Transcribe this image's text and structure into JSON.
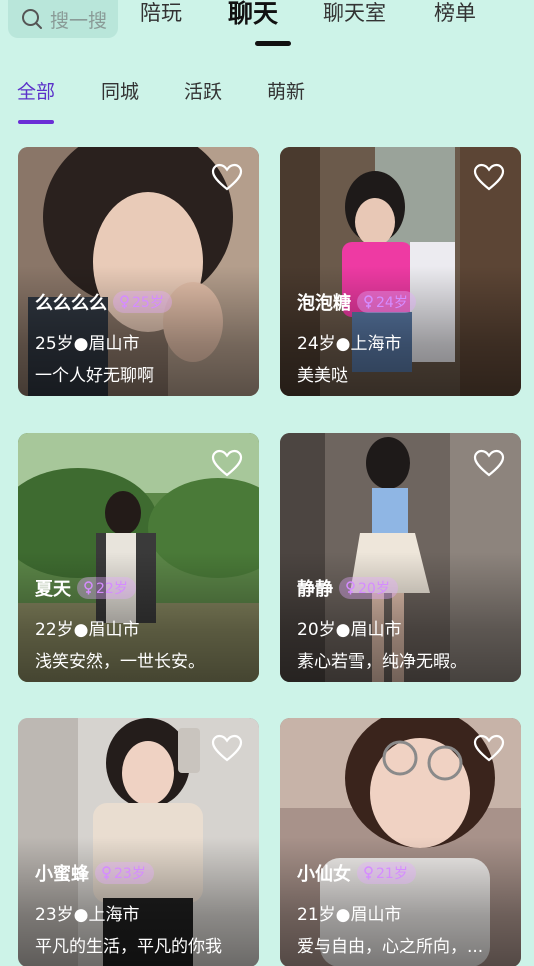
{
  "search": {
    "placeholder": "搜一搜"
  },
  "top_tabs": [
    {
      "label": "陪玩"
    },
    {
      "label": "聊天"
    },
    {
      "label": "聊天室"
    },
    {
      "label": "榜单"
    }
  ],
  "sub_tabs": [
    {
      "label": "全部"
    },
    {
      "label": "同城"
    },
    {
      "label": "活跃"
    },
    {
      "label": "萌新"
    }
  ],
  "cards": [
    {
      "name": "么么么么",
      "age_badge": "25岁",
      "info": "25岁●眉山市",
      "motto": "一个人好无聊啊"
    },
    {
      "name": "泡泡糖",
      "age_badge": "24岁",
      "info": "24岁●上海市",
      "motto": "美美哒"
    },
    {
      "name": "夏天",
      "age_badge": "22岁",
      "info": "22岁●眉山市",
      "motto": "浅笑安然，一世长安。"
    },
    {
      "name": "静静",
      "age_badge": "20岁",
      "info": "20岁●眉山市",
      "motto": "素心若雪，纯净无暇。"
    },
    {
      "name": "小蜜蜂",
      "age_badge": "23岁",
      "info": "23岁●上海市",
      "motto": "平凡的生活，平凡的你我"
    },
    {
      "name": "小仙女",
      "age_badge": "21岁",
      "info": "21岁●眉山市",
      "motto": "爱与自由，心之所向，..."
    }
  ],
  "colors": {
    "background": "#cdf3e8",
    "accent": "#5b31c9",
    "age_badge": "#d58cff"
  },
  "icons": [
    "search-icon",
    "heart-icon",
    "female-icon"
  ]
}
